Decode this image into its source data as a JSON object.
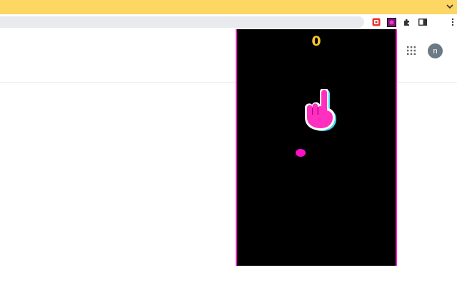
{
  "browser": {
    "colors": {
      "topbar": "#fdd663",
      "omnibox": "#e8eaed"
    },
    "toolbar_icons": [
      "record-extension-icon",
      "game-extension-icon",
      "puzzle-icon",
      "sidebar-icon",
      "profile-avatar",
      "kebab-menu-icon"
    ],
    "profile_initial": "n"
  },
  "page": {
    "header_icons": [
      "apps-grid-icon",
      "account-avatar"
    ],
    "account_initial": "n"
  },
  "game": {
    "score": "0",
    "colors": {
      "background": "#000000",
      "border": "#ff1ec8",
      "score": "#f6c431",
      "ball": "#ff10c8",
      "hand": "#ff2fbf"
    },
    "icons": [
      "pointing-hand-icon"
    ]
  }
}
